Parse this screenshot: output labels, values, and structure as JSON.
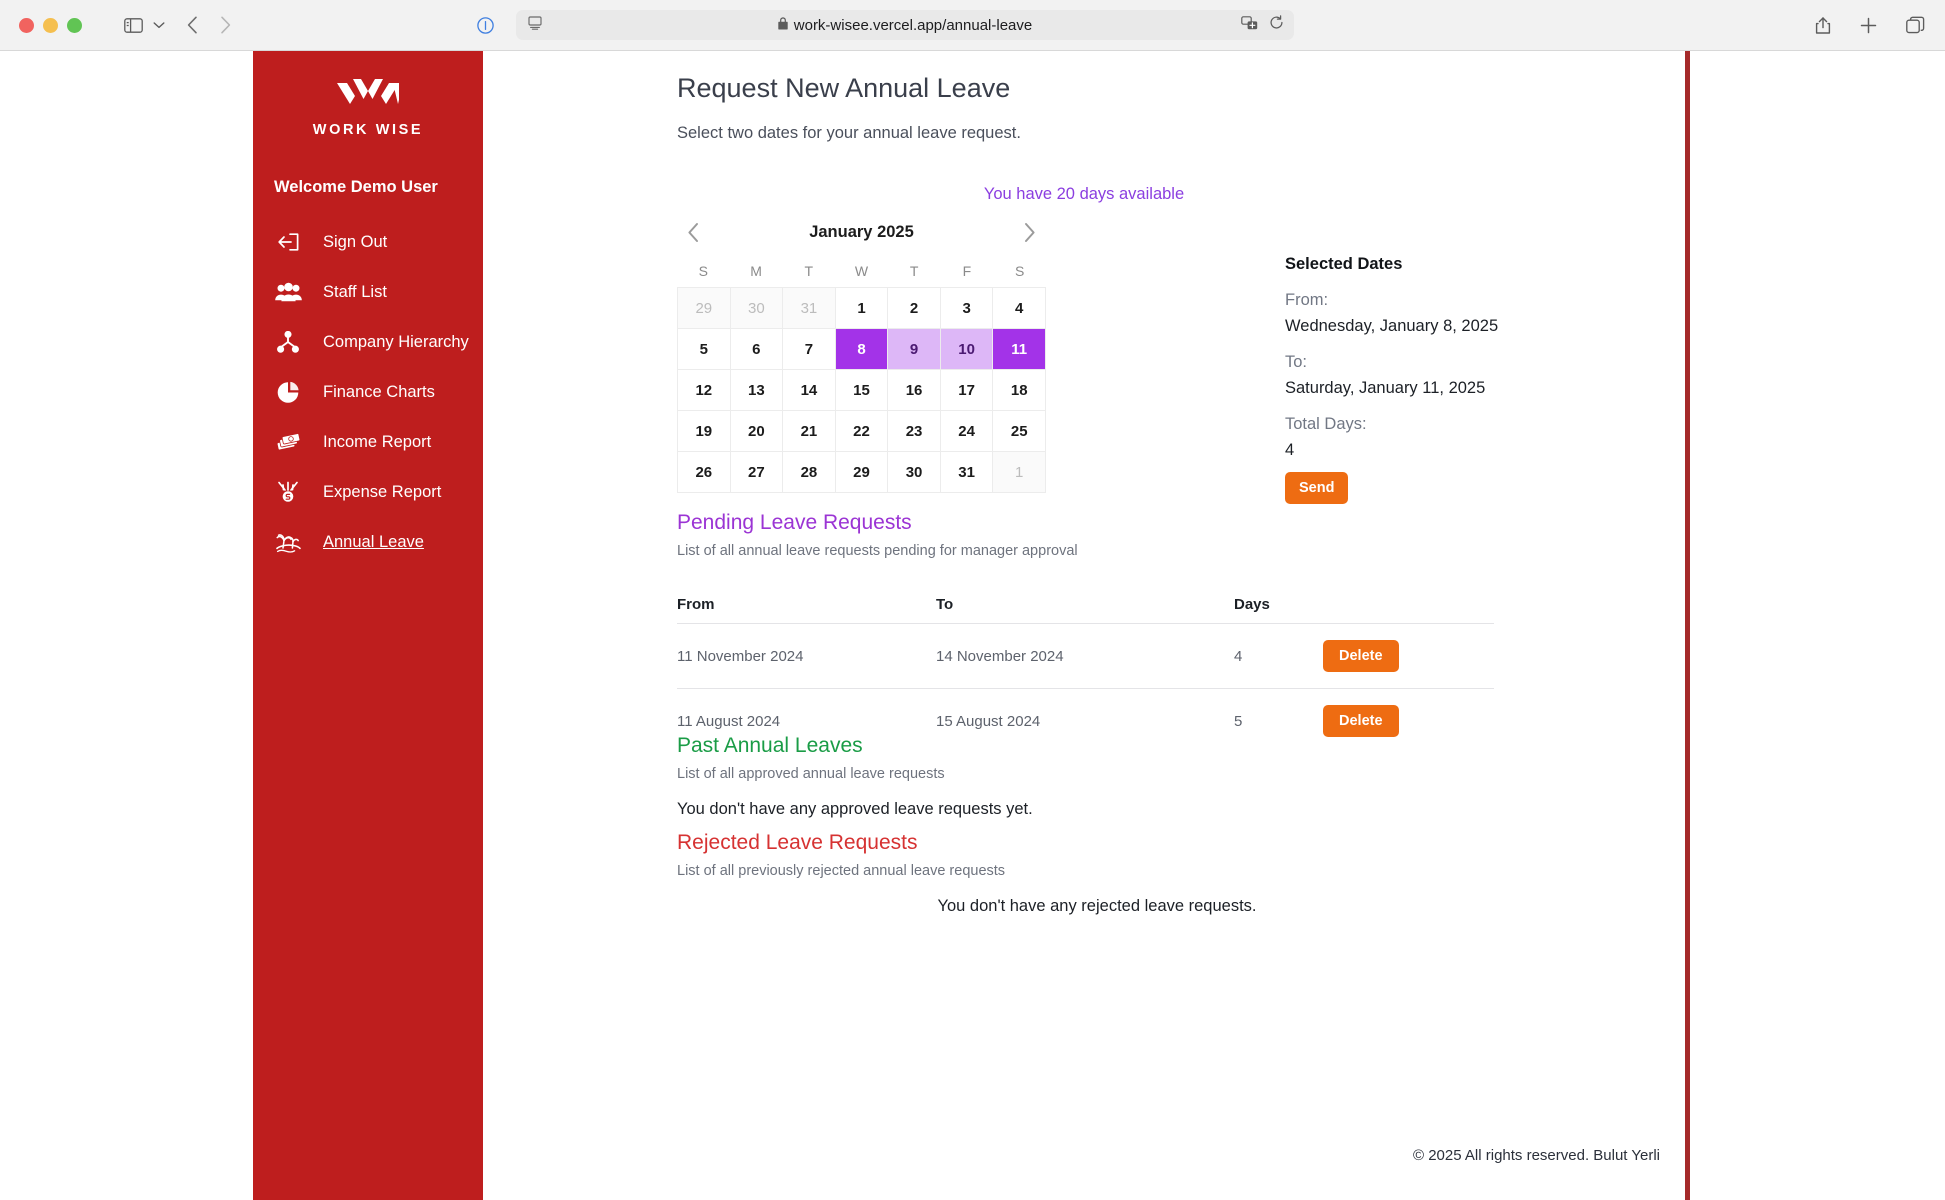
{
  "browser": {
    "url": "work-wisee.vercel.app/annual-leave",
    "lock_icon": "lock-icon",
    "info_icon": "info-icon",
    "reader_icon": "reader-view-icon",
    "translate_icon": "translate-icon",
    "reload_icon": "reload-icon",
    "share_icon": "share-icon",
    "new_tab_icon": "plus-icon",
    "tab_overview_icon": "tab-overview-icon",
    "sidebar_icon": "sidebar-toggle-icon",
    "back_icon": "chevron-left-icon",
    "forward_icon": "chevron-right-icon"
  },
  "sidebar": {
    "logo_text": "WORK WISE",
    "welcome": "Welcome Demo User",
    "items": [
      {
        "label": "Sign Out",
        "icon": "sign-out-icon",
        "active": false
      },
      {
        "label": "Staff List",
        "icon": "people-group-icon",
        "active": false
      },
      {
        "label": "Company Hierarchy",
        "icon": "hierarchy-icon",
        "active": false
      },
      {
        "label": "Finance Charts",
        "icon": "pie-chart-icon",
        "active": false
      },
      {
        "label": "Income Report",
        "icon": "money-stack-icon",
        "active": false
      },
      {
        "label": "Expense Report",
        "icon": "money-spend-icon",
        "active": false
      },
      {
        "label": "Annual Leave",
        "icon": "palm-island-icon",
        "active": true
      }
    ],
    "bg_color": "#BE1E1E"
  },
  "page": {
    "title": "Request New Annual Leave",
    "subtitle": "Select two dates for your annual leave request.",
    "days_available": "You have 20 days available",
    "accent_purple": "#8b3ee0"
  },
  "calendar": {
    "month_label": "January 2025",
    "prev_icon": "chevron-left-icon",
    "next_icon": "chevron-right-icon",
    "weekdays": [
      "S",
      "M",
      "T",
      "W",
      "T",
      "F",
      "S"
    ],
    "weeks": [
      [
        {
          "day": "29",
          "state": "muted"
        },
        {
          "day": "30",
          "state": "muted"
        },
        {
          "day": "31",
          "state": "muted"
        },
        {
          "day": "1",
          "state": "normal"
        },
        {
          "day": "2",
          "state": "normal"
        },
        {
          "day": "3",
          "state": "normal"
        },
        {
          "day": "4",
          "state": "normal"
        }
      ],
      [
        {
          "day": "5",
          "state": "normal"
        },
        {
          "day": "6",
          "state": "normal"
        },
        {
          "day": "7",
          "state": "normal"
        },
        {
          "day": "8",
          "state": "sel-edge"
        },
        {
          "day": "9",
          "state": "sel-range"
        },
        {
          "day": "10",
          "state": "sel-range"
        },
        {
          "day": "11",
          "state": "sel-edge"
        }
      ],
      [
        {
          "day": "12",
          "state": "normal"
        },
        {
          "day": "13",
          "state": "normal"
        },
        {
          "day": "14",
          "state": "normal"
        },
        {
          "day": "15",
          "state": "normal"
        },
        {
          "day": "16",
          "state": "normal"
        },
        {
          "day": "17",
          "state": "normal"
        },
        {
          "day": "18",
          "state": "normal"
        }
      ],
      [
        {
          "day": "19",
          "state": "normal"
        },
        {
          "day": "20",
          "state": "normal"
        },
        {
          "day": "21",
          "state": "normal"
        },
        {
          "day": "22",
          "state": "normal"
        },
        {
          "day": "23",
          "state": "normal"
        },
        {
          "day": "24",
          "state": "normal"
        },
        {
          "day": "25",
          "state": "normal"
        }
      ],
      [
        {
          "day": "26",
          "state": "normal"
        },
        {
          "day": "27",
          "state": "normal"
        },
        {
          "day": "28",
          "state": "normal"
        },
        {
          "day": "29",
          "state": "normal"
        },
        {
          "day": "30",
          "state": "normal"
        },
        {
          "day": "31",
          "state": "normal"
        },
        {
          "day": "1",
          "state": "muted"
        }
      ]
    ],
    "selected_edge_color": "#a333e8",
    "selected_range_color": "#ddb7f7"
  },
  "selected_dates": {
    "title": "Selected Dates",
    "from_label": "From:",
    "from_value": "Wednesday, January 8, 2025",
    "to_label": "To:",
    "to_value": "Saturday, January 11, 2025",
    "total_label": "Total Days:",
    "total_value": "4",
    "send_label": "Send",
    "send_color": "#EE6C12"
  },
  "pending": {
    "title": "Pending Leave Requests",
    "description": "List of all annual leave requests pending for manager approval",
    "title_color": "#9b34d4",
    "columns": [
      "From",
      "To",
      "Days"
    ],
    "rows": [
      {
        "from": "11 November 2024",
        "to": "14 November 2024",
        "days": "4",
        "action": "Delete"
      },
      {
        "from": "11 August 2024",
        "to": "15 August 2024",
        "days": "5",
        "action": "Delete"
      }
    ]
  },
  "past": {
    "title": "Past Annual Leaves",
    "description": "List of all approved annual leave requests",
    "empty": "You don't have any approved leave requests yet.",
    "title_color": "#1a9c46"
  },
  "rejected": {
    "title": "Rejected Leave Requests",
    "description": "List of all previously rejected annual leave requests",
    "empty": "You don't have any rejected leave requests.",
    "title_color": "#d63232"
  },
  "footer": {
    "text": "© 2025 All rights reserved. Bulut Yerli"
  }
}
